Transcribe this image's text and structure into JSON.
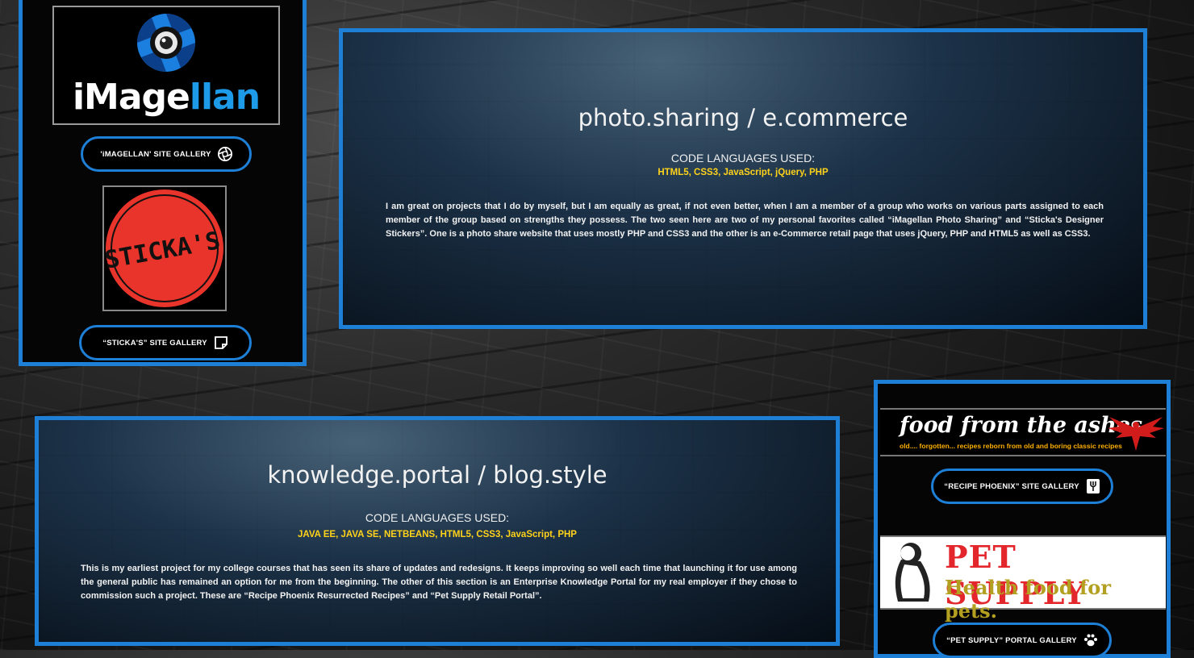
{
  "section1": {
    "title": "photo.sharing / e.commerce",
    "languages_heading": "CODE LANGUAGES USED:",
    "languages": "HTML5, CSS3, JavaScript, jQuery, PHP",
    "description": "I am great on projects that I do by myself, but I am equally as great, if not even better, when I am a member of a group who works on various parts assigned to each member of the group based on strengths they possess. The two seen here are two of my personal favorites called “iMagellan Photo Sharing” and “Sticka's Designer Stickers”. One is a photo share website that uses mostly PHP and CSS3 and the other is an e-Commerce retail page that uses jQuery, PHP and HTML5 as well as CSS3."
  },
  "section2": {
    "title": "knowledge.portal / blog.style",
    "languages_heading": "CODE LANGUAGES USED:",
    "languages": "JAVA EE, JAVA SE, NETBEANS, HTML5, CSS3, JavaScript, PHP",
    "description": "This is my earliest project for my college courses that has seen its share of updates and redesigns. It keeps improving so well each time that launching it for use among the general public has remained an option for me from the beginning. The other of this section is an Enterprise Knowledge Portal for my real employer if they chose to commission such a project. These are “Recipe Phoenix Resurrected Recipes” and “Pet Supply Retail Portal”."
  },
  "sidebar_left": {
    "imagellan_logo": {
      "prefix": "iMage",
      "suffix": "llan"
    },
    "imagellan_button": "'iMAGELLAN' SITE GALLERY",
    "sticka_logo": "STICKA'S",
    "sticka_button": "“STICKA'S” SITE GALLERY"
  },
  "sidebar_right": {
    "food_logo": "food from the ashes",
    "food_tagline": "old.... forgotten... recipes reborn from old and boring classic recipes",
    "recipe_button": "“RECIPE PHOENIX” SITE GALLERY",
    "pet_logo_line1": "PET SUPPLY",
    "pet_logo_line2": "Health food for pets.",
    "pet_button": "“PET SUPPLY” PORTAL GALLERY"
  },
  "colors": {
    "accent": "#1e7fd6",
    "language_yellow": "#ffd21a"
  },
  "icons": [
    "camera-shutter-icon",
    "sticky-note-icon",
    "fork-icon",
    "paw-icon"
  ]
}
